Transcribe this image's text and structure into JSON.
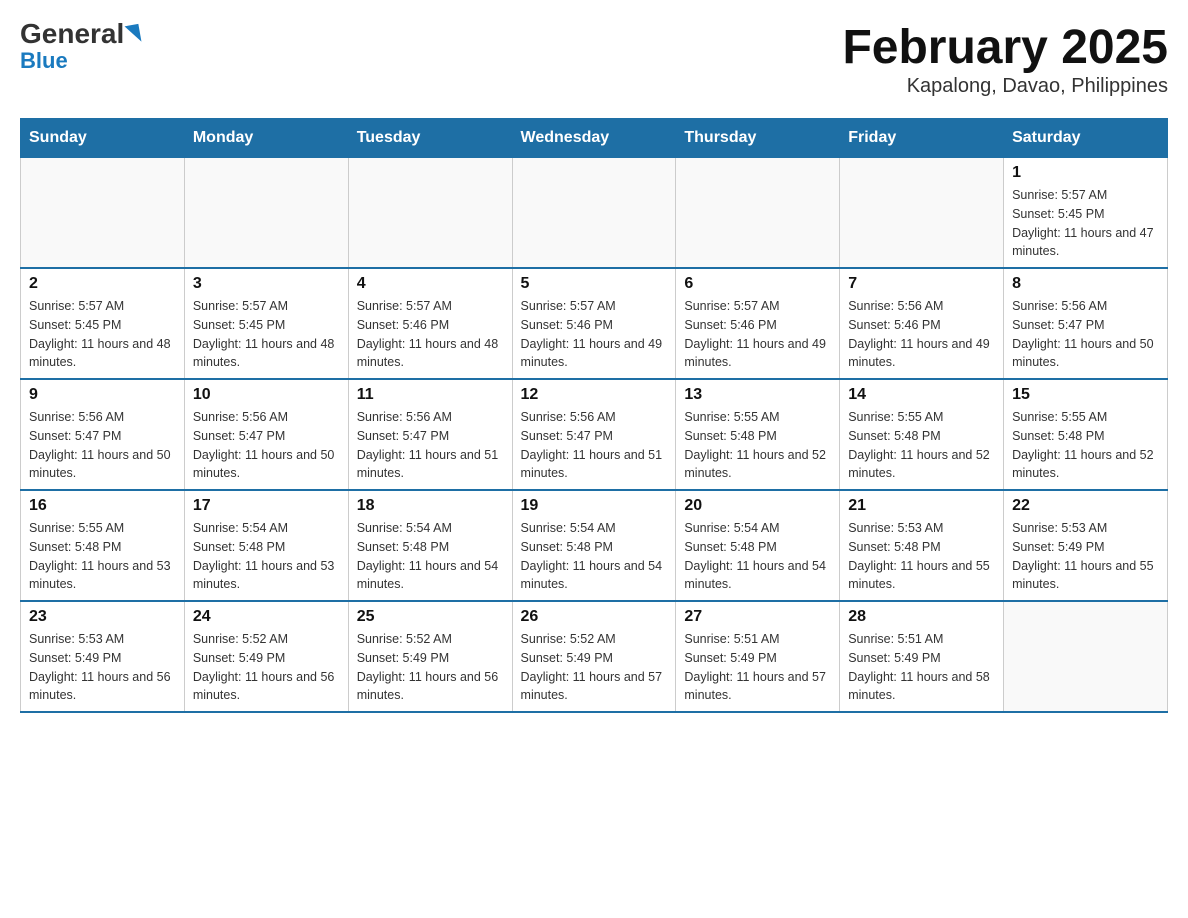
{
  "header": {
    "logo_general": "General",
    "logo_blue": "Blue",
    "title": "February 2025",
    "subtitle": "Kapalong, Davao, Philippines"
  },
  "days_of_week": [
    "Sunday",
    "Monday",
    "Tuesday",
    "Wednesday",
    "Thursday",
    "Friday",
    "Saturday"
  ],
  "weeks": [
    {
      "days": [
        {
          "num": "",
          "empty": true
        },
        {
          "num": "",
          "empty": true
        },
        {
          "num": "",
          "empty": true
        },
        {
          "num": "",
          "empty": true
        },
        {
          "num": "",
          "empty": true
        },
        {
          "num": "",
          "empty": true
        },
        {
          "num": "1",
          "sunrise": "Sunrise: 5:57 AM",
          "sunset": "Sunset: 5:45 PM",
          "daylight": "Daylight: 11 hours and 47 minutes."
        }
      ]
    },
    {
      "days": [
        {
          "num": "2",
          "sunrise": "Sunrise: 5:57 AM",
          "sunset": "Sunset: 5:45 PM",
          "daylight": "Daylight: 11 hours and 48 minutes."
        },
        {
          "num": "3",
          "sunrise": "Sunrise: 5:57 AM",
          "sunset": "Sunset: 5:45 PM",
          "daylight": "Daylight: 11 hours and 48 minutes."
        },
        {
          "num": "4",
          "sunrise": "Sunrise: 5:57 AM",
          "sunset": "Sunset: 5:46 PM",
          "daylight": "Daylight: 11 hours and 48 minutes."
        },
        {
          "num": "5",
          "sunrise": "Sunrise: 5:57 AM",
          "sunset": "Sunset: 5:46 PM",
          "daylight": "Daylight: 11 hours and 49 minutes."
        },
        {
          "num": "6",
          "sunrise": "Sunrise: 5:57 AM",
          "sunset": "Sunset: 5:46 PM",
          "daylight": "Daylight: 11 hours and 49 minutes."
        },
        {
          "num": "7",
          "sunrise": "Sunrise: 5:56 AM",
          "sunset": "Sunset: 5:46 PM",
          "daylight": "Daylight: 11 hours and 49 minutes."
        },
        {
          "num": "8",
          "sunrise": "Sunrise: 5:56 AM",
          "sunset": "Sunset: 5:47 PM",
          "daylight": "Daylight: 11 hours and 50 minutes."
        }
      ]
    },
    {
      "days": [
        {
          "num": "9",
          "sunrise": "Sunrise: 5:56 AM",
          "sunset": "Sunset: 5:47 PM",
          "daylight": "Daylight: 11 hours and 50 minutes."
        },
        {
          "num": "10",
          "sunrise": "Sunrise: 5:56 AM",
          "sunset": "Sunset: 5:47 PM",
          "daylight": "Daylight: 11 hours and 50 minutes."
        },
        {
          "num": "11",
          "sunrise": "Sunrise: 5:56 AM",
          "sunset": "Sunset: 5:47 PM",
          "daylight": "Daylight: 11 hours and 51 minutes."
        },
        {
          "num": "12",
          "sunrise": "Sunrise: 5:56 AM",
          "sunset": "Sunset: 5:47 PM",
          "daylight": "Daylight: 11 hours and 51 minutes."
        },
        {
          "num": "13",
          "sunrise": "Sunrise: 5:55 AM",
          "sunset": "Sunset: 5:48 PM",
          "daylight": "Daylight: 11 hours and 52 minutes."
        },
        {
          "num": "14",
          "sunrise": "Sunrise: 5:55 AM",
          "sunset": "Sunset: 5:48 PM",
          "daylight": "Daylight: 11 hours and 52 minutes."
        },
        {
          "num": "15",
          "sunrise": "Sunrise: 5:55 AM",
          "sunset": "Sunset: 5:48 PM",
          "daylight": "Daylight: 11 hours and 52 minutes."
        }
      ]
    },
    {
      "days": [
        {
          "num": "16",
          "sunrise": "Sunrise: 5:55 AM",
          "sunset": "Sunset: 5:48 PM",
          "daylight": "Daylight: 11 hours and 53 minutes."
        },
        {
          "num": "17",
          "sunrise": "Sunrise: 5:54 AM",
          "sunset": "Sunset: 5:48 PM",
          "daylight": "Daylight: 11 hours and 53 minutes."
        },
        {
          "num": "18",
          "sunrise": "Sunrise: 5:54 AM",
          "sunset": "Sunset: 5:48 PM",
          "daylight": "Daylight: 11 hours and 54 minutes."
        },
        {
          "num": "19",
          "sunrise": "Sunrise: 5:54 AM",
          "sunset": "Sunset: 5:48 PM",
          "daylight": "Daylight: 11 hours and 54 minutes."
        },
        {
          "num": "20",
          "sunrise": "Sunrise: 5:54 AM",
          "sunset": "Sunset: 5:48 PM",
          "daylight": "Daylight: 11 hours and 54 minutes."
        },
        {
          "num": "21",
          "sunrise": "Sunrise: 5:53 AM",
          "sunset": "Sunset: 5:48 PM",
          "daylight": "Daylight: 11 hours and 55 minutes."
        },
        {
          "num": "22",
          "sunrise": "Sunrise: 5:53 AM",
          "sunset": "Sunset: 5:49 PM",
          "daylight": "Daylight: 11 hours and 55 minutes."
        }
      ]
    },
    {
      "days": [
        {
          "num": "23",
          "sunrise": "Sunrise: 5:53 AM",
          "sunset": "Sunset: 5:49 PM",
          "daylight": "Daylight: 11 hours and 56 minutes."
        },
        {
          "num": "24",
          "sunrise": "Sunrise: 5:52 AM",
          "sunset": "Sunset: 5:49 PM",
          "daylight": "Daylight: 11 hours and 56 minutes."
        },
        {
          "num": "25",
          "sunrise": "Sunrise: 5:52 AM",
          "sunset": "Sunset: 5:49 PM",
          "daylight": "Daylight: 11 hours and 56 minutes."
        },
        {
          "num": "26",
          "sunrise": "Sunrise: 5:52 AM",
          "sunset": "Sunset: 5:49 PM",
          "daylight": "Daylight: 11 hours and 57 minutes."
        },
        {
          "num": "27",
          "sunrise": "Sunrise: 5:51 AM",
          "sunset": "Sunset: 5:49 PM",
          "daylight": "Daylight: 11 hours and 57 minutes."
        },
        {
          "num": "28",
          "sunrise": "Sunrise: 5:51 AM",
          "sunset": "Sunset: 5:49 PM",
          "daylight": "Daylight: 11 hours and 58 minutes."
        },
        {
          "num": "",
          "empty": true
        }
      ]
    }
  ]
}
